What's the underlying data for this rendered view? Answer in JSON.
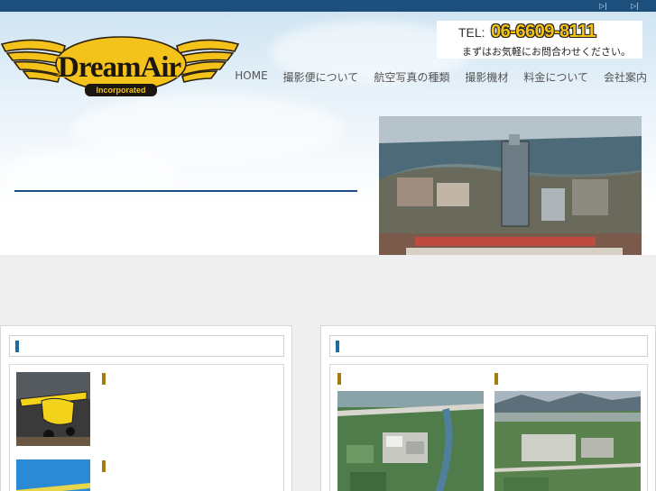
{
  "topbar": {
    "icons": [
      "play-skip-icon",
      "play-skip-icon"
    ],
    "color": "#1c4f7c"
  },
  "logo": {
    "title": "DreamAir",
    "subtitle": "Incorporated"
  },
  "contact": {
    "tel_label": "TEL:",
    "tel_number": "06-6609-8111",
    "note": "まずはお気軽にお問合わせください。"
  },
  "nav": {
    "items": [
      "HOME",
      "撮影便について",
      "航空写真の種類",
      "撮影機材",
      "料金について",
      "会社案内"
    ]
  },
  "left_panel": {
    "title": "",
    "entries": [
      {
        "title": "",
        "image": "aircraft-photo"
      },
      {
        "title": "",
        "image": "aircraft-photo"
      }
    ]
  },
  "right_panel": {
    "title": "",
    "entries": [
      {
        "title": "",
        "image": "aerial-photo"
      },
      {
        "title": "",
        "image": "aerial-photo"
      }
    ]
  },
  "colors": {
    "accent_blue": "#1d4f85",
    "accent_gold": "#a67b10",
    "tel_yellow": "#f6c410"
  }
}
